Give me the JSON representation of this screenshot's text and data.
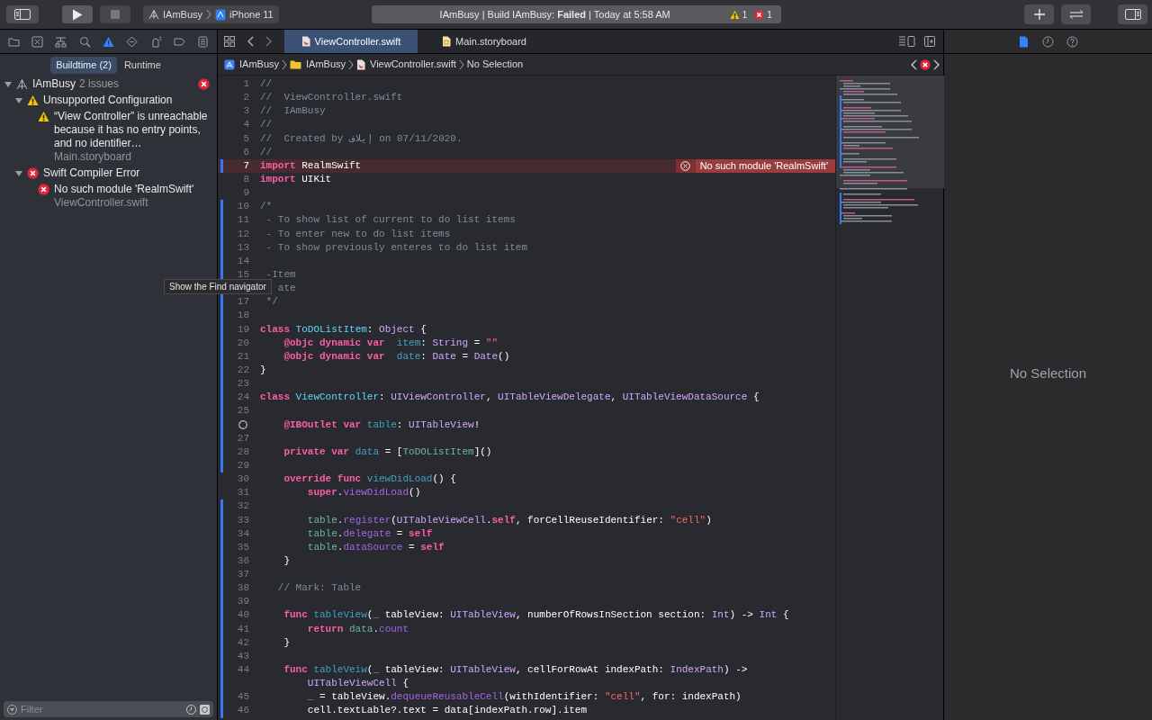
{
  "toolbar": {
    "scheme": "IAmBusy",
    "device": "iPhone 11",
    "status": "IAmBusy | Build IAmBusy: **Failed** | Today at 5:58 AM",
    "warning_count": "1",
    "error_count": "1"
  },
  "navigator": {
    "icons": [
      {
        "kind": "folder",
        "selected": false
      },
      {
        "kind": "source",
        "selected": false
      },
      {
        "kind": "hierarchy",
        "selected": false
      },
      {
        "kind": "search",
        "selected": false
      },
      {
        "kind": "issue",
        "selected": true
      },
      {
        "kind": "test",
        "selected": false
      },
      {
        "kind": "debug",
        "selected": false
      },
      {
        "kind": "breakpoint",
        "selected": false
      },
      {
        "kind": "report",
        "selected": false
      }
    ],
    "scopes": [
      {
        "label": "Buildtime (2)",
        "selected": true
      },
      {
        "label": "Runtime",
        "selected": false
      }
    ],
    "issues": [
      {
        "kind": "project",
        "label": "IAmBusy",
        "count": "2 issues",
        "expanded": true,
        "children": [
          {
            "kind": "warning",
            "label": "Unsupported Configuration",
            "expanded": true,
            "children": [
              {
                "kind": "warning",
                "label": "“View Controller” is unreachable because it has no entry points, and no identifier…",
                "file": "Main.storyboard"
              }
            ]
          },
          {
            "kind": "error",
            "label": "Swift Compiler Error",
            "expanded": true,
            "children": [
              {
                "kind": "error",
                "label": "No such module 'RealmSwift'",
                "file": "ViewController.swift"
              }
            ]
          }
        ]
      }
    ],
    "filter": {
      "placeholder": "Filter"
    }
  },
  "tooltip": "Show the Find navigator",
  "editor": {
    "tabs": [
      {
        "label": "ViewController.swift",
        "kind": "swift",
        "selected": true
      },
      {
        "label": "Main.storyboard",
        "kind": "storyboard",
        "selected": false
      }
    ],
    "jump_bar": [
      {
        "kind": "project",
        "label": "IAmBusy"
      },
      {
        "kind": "folder",
        "label": "IAmBusy"
      },
      {
        "kind": "swift",
        "label": "ViewController.swift"
      },
      {
        "kind": "none",
        "label": "No Selection"
      }
    ],
    "lines": [
      {
        "number": "1",
        "changed": false,
        "tokens": [
          {
            "kind": "comment",
            "text": "//"
          }
        ]
      },
      {
        "number": "2",
        "changed": false,
        "tokens": [
          {
            "kind": "comment",
            "text": "//  ViewController.swift"
          }
        ]
      },
      {
        "number": "3",
        "changed": false,
        "tokens": [
          {
            "kind": "comment",
            "text": "//  IAmBusy"
          }
        ]
      },
      {
        "number": "4",
        "changed": false,
        "tokens": [
          {
            "kind": "comment",
            "text": "//"
          }
        ]
      },
      {
        "number": "5",
        "changed": false,
        "tokens": [
          {
            "kind": "comment",
            "text": "//  Created by إيلاف on 07/11/2020."
          }
        ]
      },
      {
        "number": "6",
        "changed": false,
        "tokens": [
          {
            "kind": "comment",
            "text": "//"
          }
        ]
      },
      {
        "number": "7",
        "changed": true,
        "error": "No such module 'RealmSwift'",
        "tokens": [
          {
            "kind": "keyword",
            "text": "import"
          },
          {
            "kind": "plain",
            "text": " RealmSwift"
          }
        ]
      },
      {
        "number": "8",
        "changed": false,
        "tokens": [
          {
            "kind": "keyword",
            "text": "import"
          },
          {
            "kind": "plain",
            "text": " UIKit"
          }
        ]
      },
      {
        "number": "9",
        "changed": false
      },
      {
        "number": "10",
        "changed": true,
        "tokens": [
          {
            "kind": "comment",
            "text": "/*"
          }
        ]
      },
      {
        "number": "11",
        "changed": true,
        "tokens": [
          {
            "kind": "comment",
            "text": " - To show list of current to do list items"
          }
        ]
      },
      {
        "number": "12",
        "changed": true,
        "tokens": [
          {
            "kind": "comment",
            "text": " - To enter new to do list items"
          }
        ]
      },
      {
        "number": "13",
        "changed": true,
        "tokens": [
          {
            "kind": "comment",
            "text": " - To show previously enteres to do list item"
          }
        ]
      },
      {
        "number": "14",
        "changed": true
      },
      {
        "number": "15",
        "changed": true,
        "tokens": [
          {
            "kind": "comment",
            "text": " -Item"
          }
        ]
      },
      {
        "changed": true,
        "tokens": [
          {
            "kind": "comment",
            "text": "   ate"
          }
        ]
      },
      {
        "number": "17",
        "changed": true,
        "tokens": [
          {
            "kind": "comment",
            "text": " */"
          }
        ]
      },
      {
        "number": "18",
        "changed": true
      },
      {
        "number": "19",
        "changed": true,
        "tokens": [
          {
            "kind": "keyword",
            "text": "class"
          },
          {
            "kind": "decl_type",
            "text": " ToDOListItem"
          },
          {
            "kind": "plain",
            "text": ": "
          },
          {
            "kind": "type",
            "text": "Object"
          },
          {
            "kind": "plain",
            "text": " {"
          }
        ]
      },
      {
        "number": "20",
        "changed": true,
        "tokens": [
          {
            "kind": "keyword",
            "text": "    @objc dynamic var"
          },
          {
            "kind": "decl_other",
            "text": "  item"
          },
          {
            "kind": "plain",
            "text": ": "
          },
          {
            "kind": "type",
            "text": "String"
          },
          {
            "kind": "plain",
            "text": " = "
          },
          {
            "kind": "string",
            "text": "\"\""
          }
        ]
      },
      {
        "number": "21",
        "changed": true,
        "tokens": [
          {
            "kind": "keyword",
            "text": "    @objc dynamic var"
          },
          {
            "kind": "decl_other",
            "text": "  date"
          },
          {
            "kind": "plain",
            "text": ": "
          },
          {
            "kind": "type",
            "text": "Date"
          },
          {
            "kind": "plain",
            "text": " = "
          },
          {
            "kind": "type",
            "text": "Date"
          },
          {
            "kind": "plain",
            "text": "()"
          }
        ]
      },
      {
        "number": "22",
        "changed": true,
        "tokens": [
          {
            "kind": "plain",
            "text": "}"
          }
        ]
      },
      {
        "number": "23",
        "changed": true
      },
      {
        "number": "24",
        "changed": true,
        "tokens": [
          {
            "kind": "keyword",
            "text": "class"
          },
          {
            "kind": "decl_type",
            "text": " ViewController"
          },
          {
            "kind": "plain",
            "text": ": "
          },
          {
            "kind": "type",
            "text": "UIViewController"
          },
          {
            "kind": "plain",
            "text": ", "
          },
          {
            "kind": "type",
            "text": "UITableViewDelegate"
          },
          {
            "kind": "plain",
            "text": ", "
          },
          {
            "kind": "type",
            "text": "UITableViewDataSource"
          },
          {
            "kind": "plain",
            "text": " {"
          }
        ]
      },
      {
        "number": "25",
        "changed": true
      },
      {
        "outlet": true,
        "changed": true,
        "tokens": [
          {
            "kind": "keyword",
            "text": "    @IBOutlet var"
          },
          {
            "kind": "decl_other",
            "text": " table"
          },
          {
            "kind": "plain",
            "text": ": "
          },
          {
            "kind": "type",
            "text": "UITableView"
          },
          {
            "kind": "plain",
            "text": "!"
          }
        ]
      },
      {
        "number": "27",
        "changed": true
      },
      {
        "number": "28",
        "changed": true,
        "tokens": [
          {
            "kind": "keyword",
            "text": "    private var"
          },
          {
            "kind": "decl_other",
            "text": " data"
          },
          {
            "kind": "plain",
            "text": " = ["
          },
          {
            "kind": "project",
            "text": "ToDOListItem"
          },
          {
            "kind": "plain",
            "text": "]()"
          }
        ]
      },
      {
        "number": "29",
        "changed": true
      },
      {
        "number": "30",
        "changed": false,
        "tokens": [
          {
            "kind": "keyword",
            "text": "    override func"
          },
          {
            "kind": "decl_other",
            "text": " viewDidLoad"
          },
          {
            "kind": "plain",
            "text": "() {"
          }
        ]
      },
      {
        "number": "31",
        "changed": false,
        "tokens": [
          {
            "kind": "keyword",
            "text": "        super"
          },
          {
            "kind": "plain",
            "text": "."
          },
          {
            "kind": "method",
            "text": "viewDidLoad"
          },
          {
            "kind": "plain",
            "text": "()"
          }
        ]
      },
      {
        "number": "32",
        "changed": true
      },
      {
        "number": "33",
        "changed": true,
        "tokens": [
          {
            "kind": "project",
            "text": "        table"
          },
          {
            "kind": "plain",
            "text": "."
          },
          {
            "kind": "method",
            "text": "register"
          },
          {
            "kind": "plain",
            "text": "("
          },
          {
            "kind": "type",
            "text": "UITableViewCell"
          },
          {
            "kind": "plain",
            "text": "."
          },
          {
            "kind": "keyword",
            "text": "self"
          },
          {
            "kind": "plain",
            "text": ", forCellReuseIdentifier: "
          },
          {
            "kind": "string",
            "text": "\"cell\""
          },
          {
            "kind": "plain",
            "text": ")"
          }
        ]
      },
      {
        "number": "34",
        "changed": true,
        "tokens": [
          {
            "kind": "project",
            "text": "        table"
          },
          {
            "kind": "plain",
            "text": "."
          },
          {
            "kind": "method",
            "text": "delegate"
          },
          {
            "kind": "plain",
            "text": " = "
          },
          {
            "kind": "keyword",
            "text": "self"
          }
        ]
      },
      {
        "number": "35",
        "changed": true,
        "tokens": [
          {
            "kind": "project",
            "text": "        table"
          },
          {
            "kind": "plain",
            "text": "."
          },
          {
            "kind": "method",
            "text": "dataSource"
          },
          {
            "kind": "plain",
            "text": " = "
          },
          {
            "kind": "keyword",
            "text": "self"
          }
        ]
      },
      {
        "number": "36",
        "changed": true,
        "tokens": [
          {
            "kind": "plain",
            "text": "    }"
          }
        ]
      },
      {
        "number": "37",
        "changed": true
      },
      {
        "number": "38",
        "changed": true,
        "tokens": [
          {
            "kind": "comment",
            "text": "   // Mark: Table"
          }
        ]
      },
      {
        "number": "39",
        "changed": true
      },
      {
        "number": "40",
        "changed": true,
        "tokens": [
          {
            "kind": "keyword",
            "text": "    func"
          },
          {
            "kind": "decl_other",
            "text": " tableView"
          },
          {
            "kind": "plain",
            "text": "("
          },
          {
            "kind": "keyword",
            "text": "_"
          },
          {
            "kind": "plain",
            "text": " tableView: "
          },
          {
            "kind": "type",
            "text": "UITableView"
          },
          {
            "kind": "plain",
            "text": ", numberOfRowsInSection section: "
          },
          {
            "kind": "type",
            "text": "Int"
          },
          {
            "kind": "plain",
            "text": ") -> "
          },
          {
            "kind": "type",
            "text": "Int"
          },
          {
            "kind": "plain",
            "text": " {"
          }
        ]
      },
      {
        "number": "41",
        "changed": true,
        "tokens": [
          {
            "kind": "keyword",
            "text": "        return"
          },
          {
            "kind": "project",
            "text": " data"
          },
          {
            "kind": "plain",
            "text": "."
          },
          {
            "kind": "method",
            "text": "count"
          }
        ]
      },
      {
        "number": "42",
        "changed": true,
        "tokens": [
          {
            "kind": "plain",
            "text": "    }"
          }
        ]
      },
      {
        "number": "43",
        "changed": true
      },
      {
        "number": "44",
        "changed": true,
        "tokens": [
          {
            "kind": "keyword",
            "text": "    func"
          },
          {
            "kind": "decl_other",
            "text": " tableVeiw"
          },
          {
            "kind": "plain",
            "text": "("
          },
          {
            "kind": "keyword",
            "text": "_"
          },
          {
            "kind": "plain",
            "text": " tableView: "
          },
          {
            "kind": "type",
            "text": "UITableView"
          },
          {
            "kind": "plain",
            "text": ", cellForRowAt indexPath: "
          },
          {
            "kind": "type",
            "text": "IndexPath"
          },
          {
            "kind": "plain",
            "text": ") ->"
          }
        ]
      },
      {
        "changed": true,
        "tokens": [
          {
            "kind": "type",
            "text": "        UITableViewCell"
          },
          {
            "kind": "plain",
            "text": " {"
          }
        ]
      },
      {
        "number": "45",
        "changed": true,
        "tokens": [
          {
            "kind": "keyword",
            "text": "        _"
          },
          {
            "kind": "plain",
            "text": " = tableView."
          },
          {
            "kind": "method",
            "text": "dequeueReusableCell"
          },
          {
            "kind": "plain",
            "text": "(withIdentifier: "
          },
          {
            "kind": "string",
            "text": "\"cell\""
          },
          {
            "kind": "plain",
            "text": ", for: indexPath)"
          }
        ]
      },
      {
        "number": "46",
        "changed": true,
        "tokens": [
          {
            "kind": "plain",
            "text": "        cell.textLable?.text = data[indexPath.row].item"
          }
        ]
      }
    ]
  },
  "inspector": {
    "icons": [
      {
        "kind": "file",
        "selected": true
      },
      {
        "kind": "history",
        "selected": false
      },
      {
        "kind": "help",
        "selected": false
      }
    ],
    "empty_text": "No Selection"
  }
}
